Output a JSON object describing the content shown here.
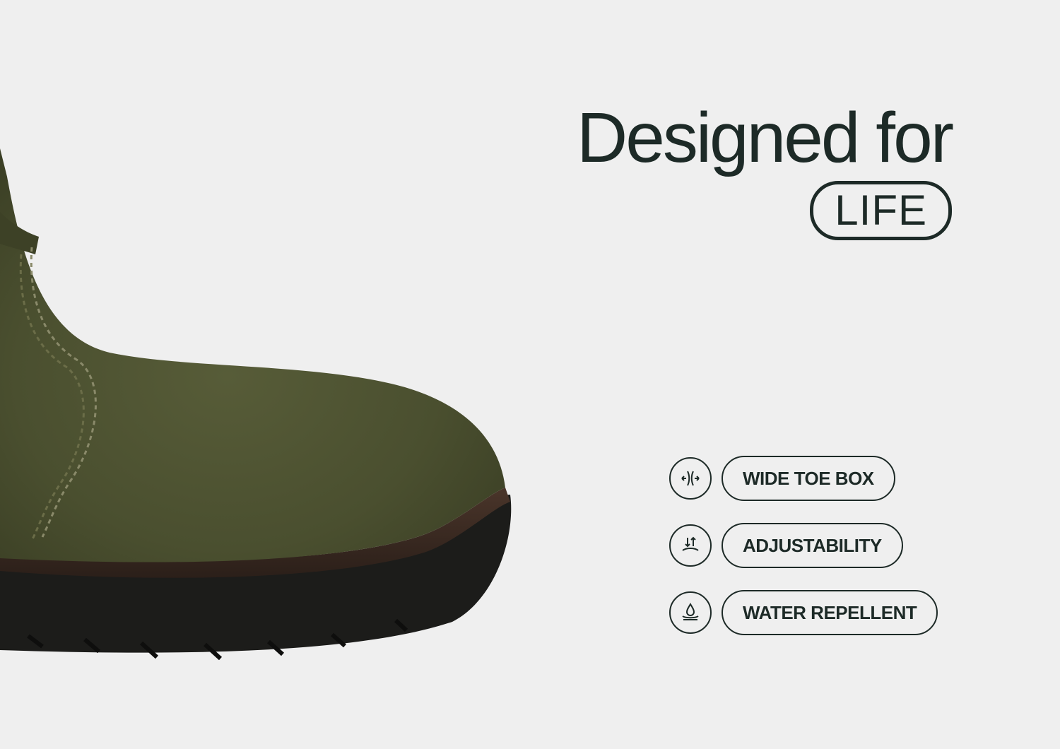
{
  "headline": {
    "main": "Designed for",
    "pill": "LIFE"
  },
  "features": [
    {
      "icon": "wide-toe-box-icon",
      "label": "WIDE TOE BOX"
    },
    {
      "icon": "adjustability-icon",
      "label": "ADJUSTABILITY"
    },
    {
      "icon": "water-drop-icon",
      "label": "WATER REPELLENT"
    }
  ],
  "colors": {
    "background": "#efefef",
    "ink": "#1d2a27",
    "suede": "#4a4f30",
    "sole": "#1a1a18",
    "welt": "#3a2a22"
  }
}
